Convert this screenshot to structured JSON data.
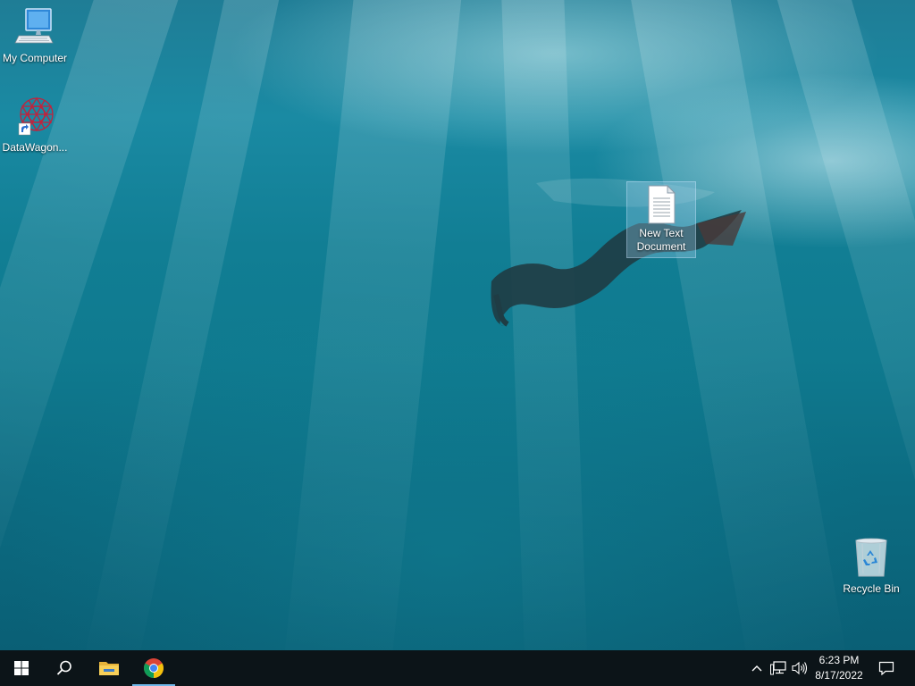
{
  "desktop": {
    "icons": [
      {
        "label": "My Computer"
      },
      {
        "label": "DataWagon..."
      },
      {
        "label": "New Text Document"
      },
      {
        "label": "Recycle Bin"
      }
    ]
  },
  "taskbar": {
    "start_icon": "windows-start-icon",
    "search_icon": "search-icon",
    "pinned": [
      {
        "icon": "file-explorer-icon"
      },
      {
        "icon": "chrome-icon",
        "active": true
      }
    ],
    "tray": {
      "icons": [
        "chevron-up-icon",
        "network-icon",
        "volume-icon"
      ],
      "time": "6:23 PM",
      "date": "8/17/2022",
      "notification_icon": "action-center-icon"
    }
  },
  "colors": {
    "taskbar_bg": "#0c1418",
    "active_indicator": "#6fb7e8",
    "water_accent": "#117e94"
  }
}
